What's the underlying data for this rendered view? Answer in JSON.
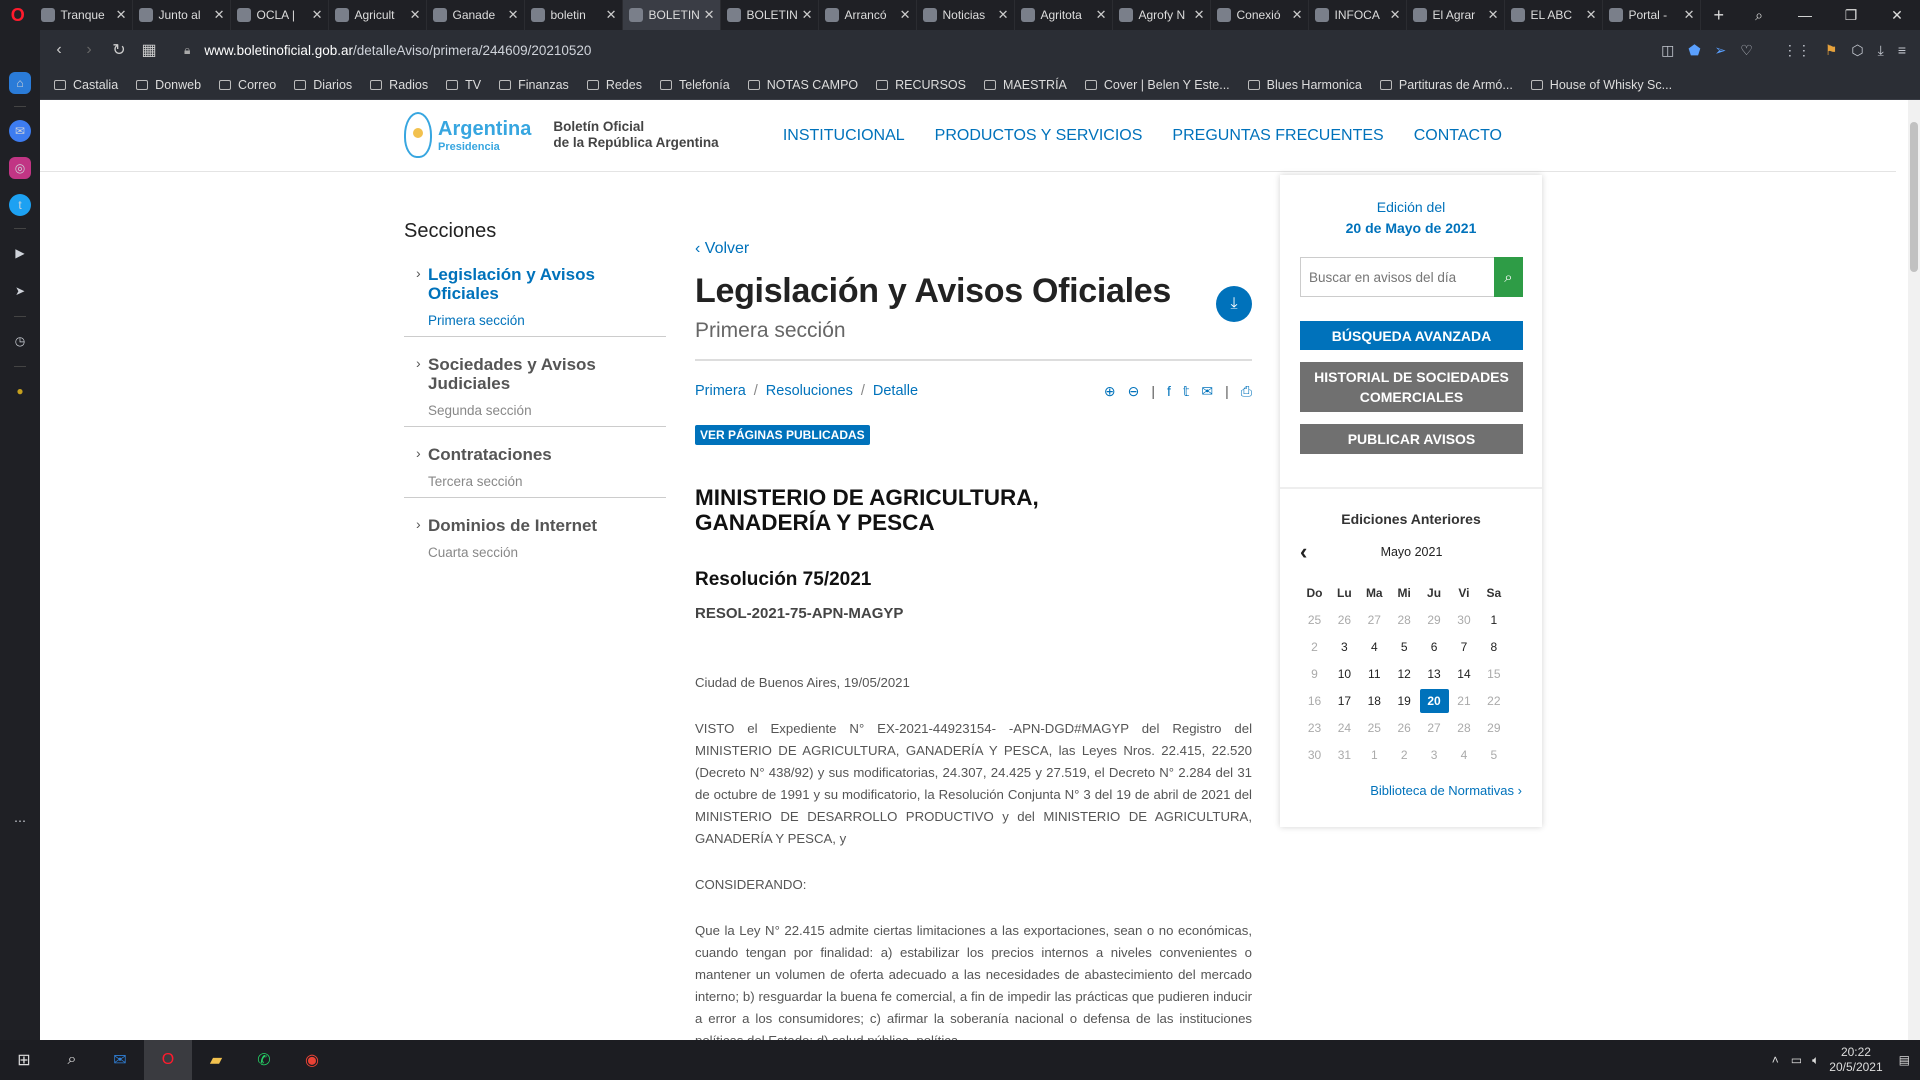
{
  "browser": {
    "tabs": [
      {
        "title": "Tranque",
        "active": false
      },
      {
        "title": "Junto al",
        "active": false
      },
      {
        "title": "OCLA | ",
        "active": false
      },
      {
        "title": "Agricult",
        "active": false
      },
      {
        "title": "Ganade",
        "active": false
      },
      {
        "title": "boletin",
        "active": false
      },
      {
        "title": "BOLETIN",
        "active": true
      },
      {
        "title": "BOLETIN",
        "active": false
      },
      {
        "title": "Arrancó",
        "active": false
      },
      {
        "title": "Noticias",
        "active": false
      },
      {
        "title": "Agritota",
        "active": false
      },
      {
        "title": "Agrofy N",
        "active": false
      },
      {
        "title": "Conexió",
        "active": false
      },
      {
        "title": "INFOCA",
        "active": false
      },
      {
        "title": "El Agrar",
        "active": false
      },
      {
        "title": "EL ABC",
        "active": false
      },
      {
        "title": "Portal -",
        "active": false
      }
    ],
    "url_domain": "www.boletinoficial.gob.ar",
    "url_path": "/detalleAviso/primera/244609/20210520",
    "bookmarks": [
      "Castalia",
      "Donweb",
      "Correo",
      "Diarios",
      "Radios",
      "TV",
      "Finanzas",
      "Redes",
      "Telefonía",
      "NOTAS CAMPO",
      "RECURSOS",
      "MAESTRÍA",
      "Cover | Belen Y Este...",
      "Blues Harmonica",
      "Partituras de Armó...",
      "House of Whisky Sc..."
    ]
  },
  "site": {
    "logo_main": "Argentina",
    "logo_sub": "Presidencia",
    "logo_bo1": "Boletín Oficial",
    "logo_bo2": "de la República Argentina",
    "nav": [
      "INSTITUCIONAL",
      "PRODUCTOS Y SERVICIOS",
      "PREGUNTAS FRECUENTES",
      "CONTACTO"
    ]
  },
  "sections": {
    "heading": "Secciones",
    "items": [
      {
        "title": "Legislación y Avisos Oficiales",
        "sub": "Primera sección",
        "active": true
      },
      {
        "title": "Sociedades y Avisos Judiciales",
        "sub": "Segunda sección",
        "active": false
      },
      {
        "title": "Contrataciones",
        "sub": "Tercera sección",
        "active": false
      },
      {
        "title": "Dominios de Internet",
        "sub": "Cuarta sección",
        "active": false
      }
    ]
  },
  "main": {
    "volver": "Volver",
    "title": "Legislación y Avisos Oficiales",
    "subtitle": "Primera sección",
    "breadcrumb": [
      "Primera",
      "Resoluciones",
      "Detalle"
    ],
    "paginas_btn": "VER PÁGINAS PUBLICADAS",
    "ministerio": "MINISTERIO DE AGRICULTURA, GANADERÍA Y PESCA",
    "resolucion": "Resolución 75/2021",
    "resol_code": "RESOL-2021-75-APN-MAGYP",
    "ciudad": "Ciudad de Buenos Aires, 19/05/2021",
    "visto": "VISTO el Expediente N° EX-2021-44923154- -APN-DGD#MAGYP del Registro del MINISTERIO DE AGRICULTURA, GANADERÍA Y PESCA, las Leyes Nros. 22.415, 22.520 (Decreto N° 438/92) y sus modificatorias, 24.307, 24.425 y 27.519, el Decreto N° 2.284 del 31 de octubre de 1991 y su modificatorio, la Resolución Conjunta N° 3 del 19 de abril de 2021 del MINISTERIO DE DESARROLLO PRODUCTIVO y del MINISTERIO DE AGRICULTURA, GANADERÍA Y PESCA, y",
    "considerando": "CONSIDERANDO:",
    "p1": "Que la Ley N° 22.415 admite ciertas limitaciones a las exportaciones, sean o no económicas, cuando tengan por finalidad: a) estabilizar los precios internos a niveles convenientes o mantener un volumen de oferta adecuado a las necesidades de abastecimiento del mercado interno; b) resguardar la buena fe comercial, a fin de impedir las prácticas que pudieren inducir a error a los consumidores; c) afirmar la soberanía nacional o defensa de las instituciones políticas del Estado; d) salud pública, política"
  },
  "panel": {
    "edicion_label": "Edición del",
    "edicion_fecha": "20 de Mayo de 2021",
    "search_placeholder": "Buscar en avisos del día",
    "btn_busqueda": "BÚSQUEDA AVANZADA",
    "btn_historial": "HISTORIAL DE SOCIEDADES COMERCIALES",
    "btn_publicar": "PUBLICAR AVISOS",
    "ediciones_anteriores": "Ediciones Anteriores",
    "calendar_month": "Mayo 2021",
    "weekdays": [
      "Do",
      "Lu",
      "Ma",
      "Mi",
      "Ju",
      "Vi",
      "Sa"
    ],
    "weeks": [
      [
        {
          "d": "25",
          "m": true
        },
        {
          "d": "26",
          "m": true
        },
        {
          "d": "27",
          "m": true
        },
        {
          "d": "28",
          "m": true
        },
        {
          "d": "29",
          "m": true
        },
        {
          "d": "30",
          "m": true
        },
        {
          "d": "1",
          "m": false
        }
      ],
      [
        {
          "d": "2",
          "m": true
        },
        {
          "d": "3",
          "m": false
        },
        {
          "d": "4",
          "m": false
        },
        {
          "d": "5",
          "m": false
        },
        {
          "d": "6",
          "m": false
        },
        {
          "d": "7",
          "m": false
        },
        {
          "d": "8",
          "m": false
        }
      ],
      [
        {
          "d": "9",
          "m": true
        },
        {
          "d": "10",
          "m": false
        },
        {
          "d": "11",
          "m": false
        },
        {
          "d": "12",
          "m": false
        },
        {
          "d": "13",
          "m": false
        },
        {
          "d": "14",
          "m": false
        },
        {
          "d": "15",
          "m": true
        }
      ],
      [
        {
          "d": "16",
          "m": true
        },
        {
          "d": "17",
          "m": false
        },
        {
          "d": "18",
          "m": false
        },
        {
          "d": "19",
          "m": false
        },
        {
          "d": "20",
          "m": false,
          "sel": true
        },
        {
          "d": "21",
          "m": true
        },
        {
          "d": "22",
          "m": true
        }
      ],
      [
        {
          "d": "23",
          "m": true
        },
        {
          "d": "24",
          "m": true
        },
        {
          "d": "25",
          "m": true
        },
        {
          "d": "26",
          "m": true
        },
        {
          "d": "27",
          "m": true
        },
        {
          "d": "28",
          "m": true
        },
        {
          "d": "29",
          "m": true
        }
      ],
      [
        {
          "d": "30",
          "m": true
        },
        {
          "d": "31",
          "m": true
        },
        {
          "d": "1",
          "m": true
        },
        {
          "d": "2",
          "m": true
        },
        {
          "d": "3",
          "m": true
        },
        {
          "d": "4",
          "m": true
        },
        {
          "d": "5",
          "m": true
        }
      ]
    ],
    "biblioteca": "Biblioteca de Normativas"
  },
  "taskbar": {
    "time": "20:22",
    "date": "20/5/2021"
  },
  "colors": {
    "brand_blue": "#0072bb",
    "search_green": "#2e9c46",
    "gray_btn": "#707070"
  }
}
